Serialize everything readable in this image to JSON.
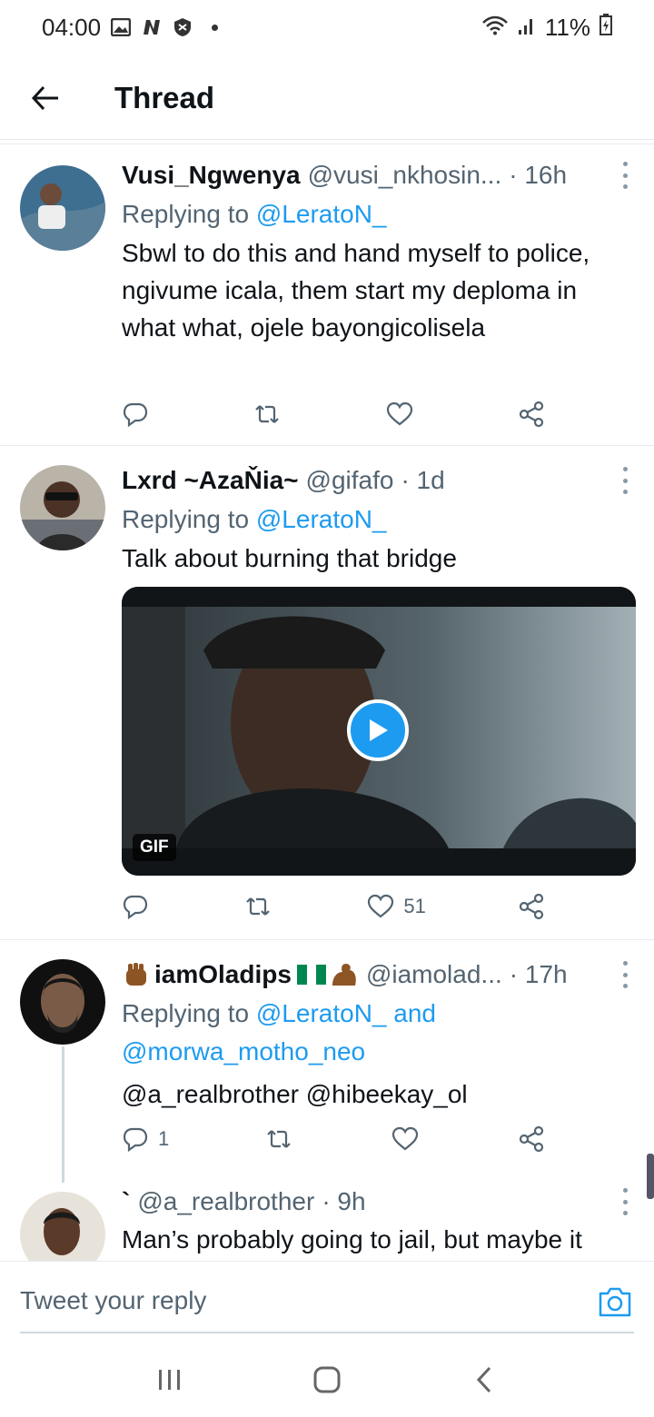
{
  "status_bar": {
    "time": "04:00",
    "battery": "11%",
    "left_icons": [
      "gallery-icon",
      "n-icon",
      "shield-icon"
    ],
    "right_icons": [
      "wifi-icon",
      "signal-icon",
      "battery-icon"
    ]
  },
  "header": {
    "title": "Thread"
  },
  "tweets": [
    {
      "name": "Vusi_Ngwenya",
      "handle": "@vusi_nkhosin...",
      "time": "· 16h",
      "replying_prefix": "Replying to ",
      "replying_to": "@LeratoN_",
      "text": "Sbwl to do this and hand myself to police, ngivume icala, them start my deploma in what what, ojele bayongicolisela"
    },
    {
      "name": "Lxrd ~AzaŇia~",
      "handle": "@gifafo",
      "time": "· 1d",
      "replying_prefix": "Replying to ",
      "replying_to": "@LeratoN_",
      "text": "Talk about burning that bridge",
      "media_badge": "GIF",
      "like_count": "51"
    },
    {
      "name": "iamOladips",
      "handle": "@iamolad...",
      "time": "· 17h",
      "replying_prefix": "Replying to ",
      "replying_to": "@LeratoN_",
      "replying_and": " and",
      "replying_to_2": "@morwa_motho_neo",
      "text_mentions": "@a_realbrother @hibeekay_ol",
      "reply_count": "1"
    },
    {
      "name": "`",
      "handle": "@a_realbrother",
      "time": "· 9h",
      "text": "Man’s probably going to jail, but maybe it"
    }
  ],
  "reply_bar": {
    "placeholder": "Tweet your reply"
  },
  "colors": {
    "link": "#1d9bf0",
    "secondary_text": "#536471",
    "divider": "#e7eaec"
  }
}
